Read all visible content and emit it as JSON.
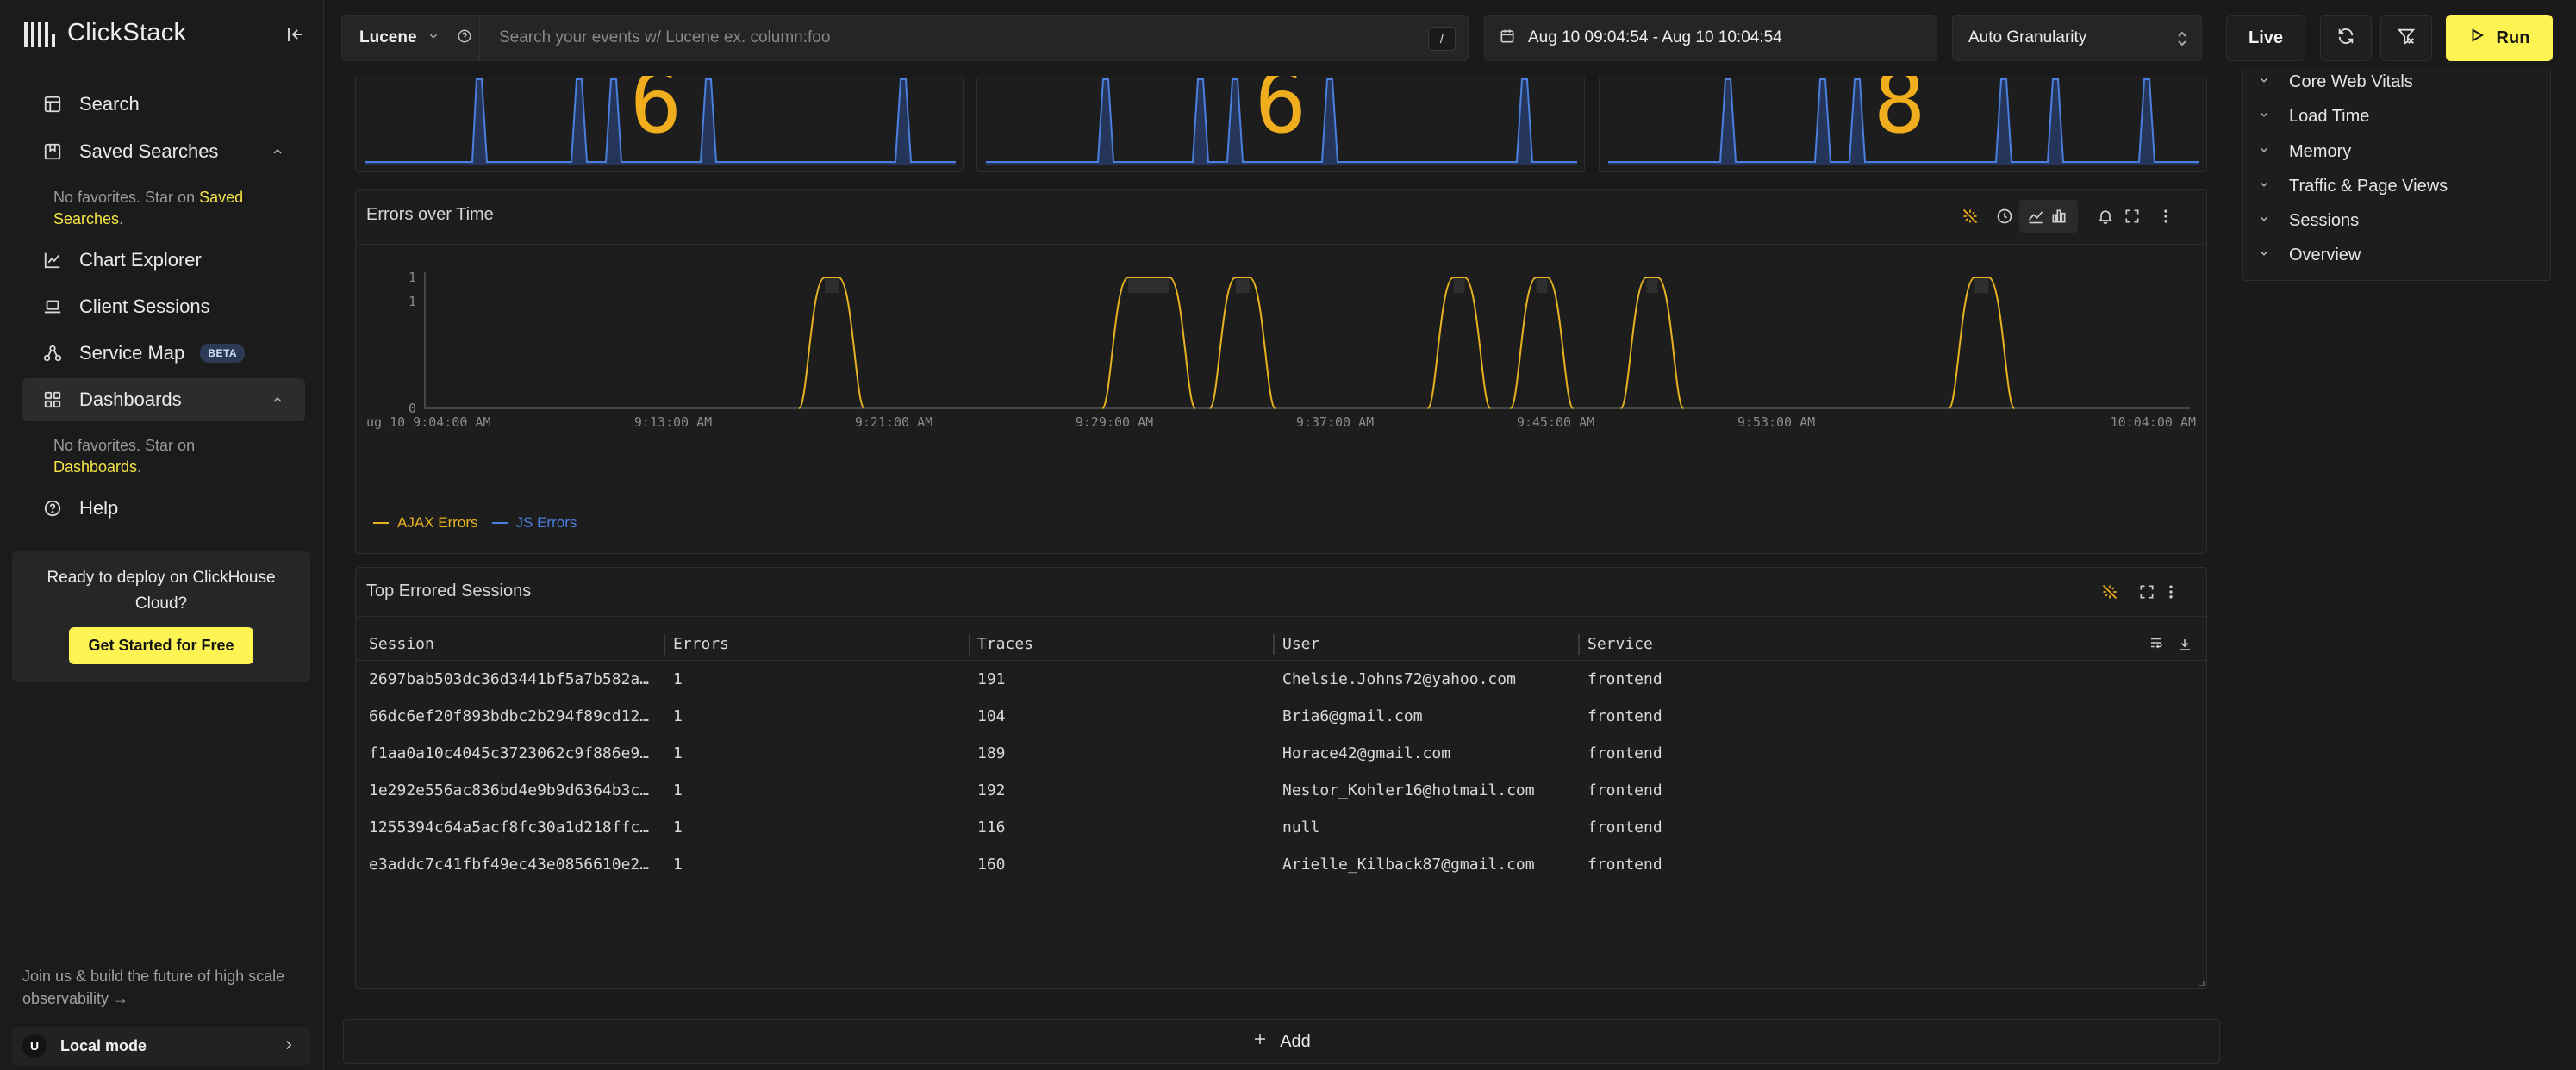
{
  "app": {
    "name": "ClickStack"
  },
  "sidebar": {
    "items": [
      {
        "label": "Search",
        "icon": "table-icon"
      },
      {
        "label": "Saved Searches",
        "icon": "bookmark-icon"
      },
      {
        "label": "Chart Explorer",
        "icon": "chart-line-icon"
      },
      {
        "label": "Client Sessions",
        "icon": "laptop-icon"
      },
      {
        "label": "Service Map",
        "icon": "service-map-icon",
        "badge": "BETA"
      },
      {
        "label": "Dashboards",
        "icon": "dashboard-grid-icon"
      },
      {
        "label": "Help",
        "icon": "help-icon"
      }
    ],
    "saved_searches_note": {
      "text": "No favorites. Star on ",
      "link": "Saved Searches",
      "suffix": "."
    },
    "dashboards_note": {
      "text": "No favorites. Star on ",
      "link": "Dashboards",
      "suffix": "."
    },
    "deploy": {
      "title": "Ready to deploy on ClickHouse Cloud?",
      "button": "Get Started for Free"
    },
    "join": "Join us & build the future of high scale observability →",
    "local": {
      "avatar": "U",
      "label": "Local mode"
    }
  },
  "topbar": {
    "language": "Lucene",
    "search_placeholder": "Search your events w/ Lucene ex. column:foo",
    "shortcut": "/",
    "date_range": "Aug 10 09:04:54 - Aug 10 10:04:54",
    "granularity": "Auto Granularity",
    "live": "Live",
    "run": "Run"
  },
  "kpi_tiles": [
    {
      "value": "6"
    },
    {
      "value": "6"
    },
    {
      "value": "8"
    }
  ],
  "errors_chart": {
    "title": "Errors over Time",
    "legend": [
      {
        "name": "AJAX Errors",
        "color": "#e6b21f"
      },
      {
        "name": "JS Errors",
        "color": "#4a7fe0"
      }
    ]
  },
  "chart_data": {
    "type": "line",
    "title": "Errors over Time",
    "xlabel": "",
    "ylabel": "",
    "ytick_labels": [
      "0",
      "1",
      "1"
    ],
    "ylim": [
      0,
      1
    ],
    "xtick_labels": [
      "ug 10 9:04:00 AM",
      "9:13:00 AM",
      "9:21:00 AM",
      "9:29:00 AM",
      "9:37:00 AM",
      "9:45:00 AM",
      "9:53:00 AM",
      "10:04:00 AM"
    ],
    "x_minutes": [
      0,
      64
    ],
    "series": [
      {
        "name": "AJAX Errors",
        "color": "#e6b21f",
        "pulses": [
          [
            14.0,
            15.5
          ],
          [
            25.0,
            27.5
          ],
          [
            28.9,
            30.4
          ],
          [
            36.8,
            38.2
          ],
          [
            39.8,
            41.2
          ],
          [
            43.8,
            45.2
          ],
          [
            55.7,
            57.2
          ]
        ],
        "value": 1
      },
      {
        "name": "JS Errors",
        "color": "#4a7fe0",
        "pulses": [],
        "value": 0
      }
    ],
    "legend_position": "bottom-left",
    "grid": false
  },
  "sessions_table": {
    "title": "Top Errored Sessions",
    "columns": [
      "Session",
      "Errors",
      "Traces",
      "User",
      "Service"
    ],
    "rows": [
      [
        "2697bab503dc36d3441bf5a7b582a…",
        "1",
        "191",
        "Chelsie.Johns72@yahoo.com",
        "frontend"
      ],
      [
        "66dc6ef20f893bdbc2b294f89cd12…",
        "1",
        "104",
        "Bria6@gmail.com",
        "frontend"
      ],
      [
        "f1aa0a10c4045c3723062c9f886e9…",
        "1",
        "189",
        "Horace42@gmail.com",
        "frontend"
      ],
      [
        "1e292e556ac836bd4e9b9d6364b3c…",
        "1",
        "192",
        "Nestor_Kohler16@hotmail.com",
        "frontend"
      ],
      [
        "1255394c64a5acf8fc30a1d218ffc…",
        "1",
        "116",
        "null",
        "frontend"
      ],
      [
        "e3addc7c41fbf49ec43e0856610e2…",
        "1",
        "160",
        "Arielle_Kilback87@gmail.com",
        "frontend"
      ]
    ]
  },
  "right_panel": {
    "items": [
      "Core Web Vitals",
      "Load Time",
      "Memory",
      "Traffic & Page Views",
      "Sessions",
      "Overview"
    ]
  },
  "add_button": "Add",
  "colors": {
    "accent": "#fdf352",
    "ajax": "#e6b21f",
    "js": "#4a7fe0"
  }
}
